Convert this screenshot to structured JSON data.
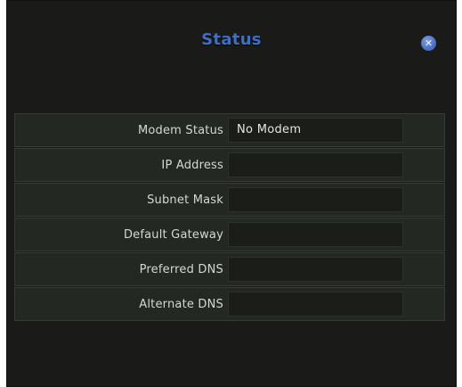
{
  "dialog": {
    "title": "Status",
    "close_glyph": "✕",
    "close_icon": "close-circle-icon"
  },
  "fields": [
    {
      "label": "Modem Status",
      "value": "No Modem"
    },
    {
      "label": "IP Address",
      "value": ""
    },
    {
      "label": "Subnet Mask",
      "value": ""
    },
    {
      "label": "Default Gateway",
      "value": ""
    },
    {
      "label": "Preferred DNS",
      "value": ""
    },
    {
      "label": "Alternate DNS",
      "value": ""
    }
  ],
  "colors": {
    "title": "#3f6fc4",
    "background": "#1a1a19",
    "row_background": "#242823",
    "close_button": "#4f75c8"
  }
}
